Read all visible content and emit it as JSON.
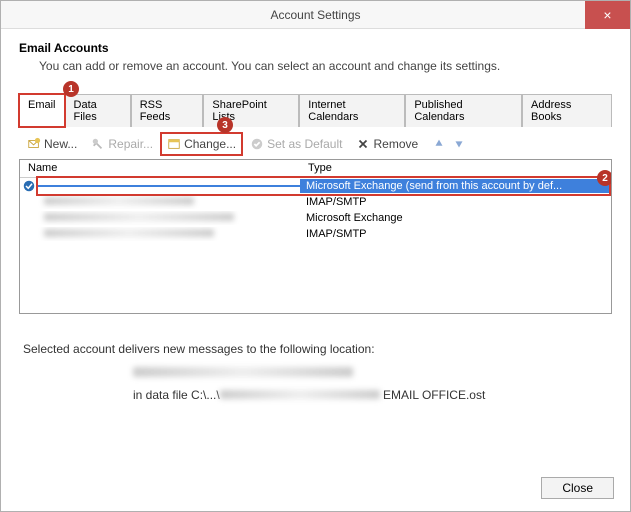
{
  "window": {
    "title": "Account Settings",
    "close": "×"
  },
  "header": {
    "title": "Email Accounts",
    "desc": "You can add or remove an account. You can select an account and change its settings."
  },
  "badges": {
    "b1": "1",
    "b2": "2",
    "b3": "3"
  },
  "tabs": {
    "email": "Email",
    "datafiles": "Data Files",
    "rss": "RSS Feeds",
    "sharepoint": "SharePoint Lists",
    "ical": "Internet Calendars",
    "pub": "Published Calendars",
    "addr": "Address Books"
  },
  "toolbar": {
    "new": "New...",
    "repair": "Repair...",
    "change": "Change...",
    "default": "Set as Default",
    "remove": "Remove"
  },
  "columns": {
    "name": "Name",
    "type": "Type"
  },
  "rows": [
    {
      "type": "Microsoft Exchange (send from this account by def..."
    },
    {
      "type": "IMAP/SMTP"
    },
    {
      "type": "Microsoft Exchange"
    },
    {
      "type": "IMAP/SMTP"
    }
  ],
  "deliver": {
    "intro": "Selected account delivers new messages to the following location:",
    "line3_prefix": "in data file C:\\...\\",
    "line3_suffix": "   EMAIL OFFICE.ost"
  },
  "footer": {
    "close": "Close"
  }
}
